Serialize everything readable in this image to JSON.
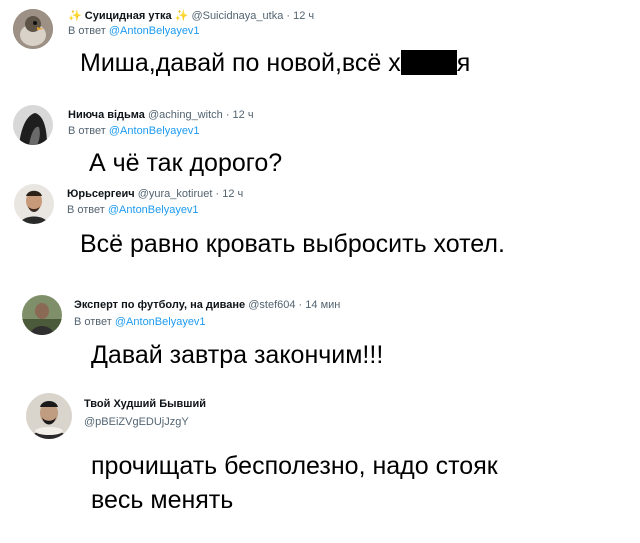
{
  "replies": [
    {
      "name": "Суицидная утка",
      "name_emoji": "✨",
      "handle": "@Suicidnaya_utka",
      "time": "12 ч",
      "reply_prefix": "В ответ",
      "reply_to": "@AntonBelyayev1",
      "text": "Миша,давай по новой,всё х",
      "text_end": "я",
      "avatar_color": "#8a7e74"
    },
    {
      "name": "Ниюча відьма",
      "handle": "@aching_witch",
      "time": "12 ч",
      "reply_prefix": "В ответ",
      "reply_to": "@AntonBelyayev1",
      "text": "А чё так дорого?",
      "avatar_color": "#2e2e2e"
    },
    {
      "name": "Юрьсергеич",
      "handle": "@yura_kotiruet",
      "time": "12 ч",
      "reply_prefix": "В ответ",
      "reply_to": "@AntonBelyayev1",
      "text": "Всё равно кровать выбросить хотел.",
      "avatar_color": "#6b4a3a"
    },
    {
      "name": "Эксперт по футболу, на диване",
      "handle": "@stef604",
      "time": "14 мин",
      "reply_prefix": "В ответ",
      "reply_to": "@AntonBelyayev1",
      "text": "Давай завтра закончим!!!",
      "avatar_color": "#5f6e4f"
    },
    {
      "name": "Твой Худший Бывший",
      "handle": "@pBEiZVgEDUjJzgY",
      "text_line1": "прочищать бесполезно, надо стояк",
      "text_line2": "весь менять",
      "avatar_color": "#3a3a3a"
    }
  ]
}
